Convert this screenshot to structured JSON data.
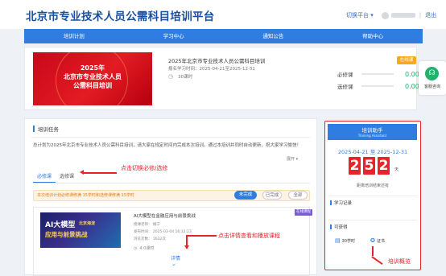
{
  "header": {
    "title": "北京市专业技术人员公需科目培训平台",
    "switch_platform": "切换平台 ▾",
    "logout": "退出",
    "separator": "|"
  },
  "nav": {
    "items": [
      "培训计划",
      "学习中心",
      "通知公告",
      "帮助中心"
    ]
  },
  "plan_card": {
    "cover_text_line1": "2025年",
    "cover_text_line2": "北京市专业技术人员",
    "cover_text_line3": "公需科目培训",
    "title": "2025年北京市专业技术人员公需科目培训",
    "date": "报名学习时间：2025-04-21至2025-12-31",
    "hours": "30课时",
    "badge": "在线课",
    "required_label": "必修课",
    "required_value": "0.00%",
    "elective_label": "选修课",
    "elective_value": "0.00%"
  },
  "float_widget": {
    "label": "客服咨询"
  },
  "task_card": {
    "section_title": "培训任务",
    "plan_text": "总计划为2025年北京市专业技术人员公需科目培训，请大家在规定时间内完成本次培训。通过本培训并同时自动更新，祝大家学习愉快！",
    "more": "展开 ▾",
    "tab_required": "必修课",
    "tab_elective": "选修课",
    "notice": "本次培训计划必修课修满 15学时和选修课修满 15学时",
    "filters": [
      "未完成",
      "已完成",
      "全部"
    ]
  },
  "course": {
    "img_line1": "AI大模型",
    "img_line2": "应用与前景挑战",
    "img_tag": "北京海淀",
    "tag": "在线课程",
    "title": "AI大模型在金融应用与前景挑战",
    "teacher": "授课老师：  姚宁",
    "time": "发布时间：  2025-03-04 16:32:23",
    "views": "浏览次数：  1632次",
    "hours": "4.0课时",
    "detail": "详情",
    "chevron": "⌄"
  },
  "assistant": {
    "title": "培训助手",
    "subtitle": "Training Assistant",
    "date": "2025-04-21 至 2025-12-31",
    "digits": [
      "2",
      "5",
      "2"
    ],
    "unit": "天",
    "remaining": "距离培训结束还有",
    "study_records": "学习记录",
    "earned": "可获得",
    "hours_earned": "30学时",
    "certificate": "证书"
  },
  "annotations": {
    "tab_hint": "点击切换必修/选修",
    "detail_hint": "点击详情查看和播放课程",
    "overview_hint": "培训概览"
  }
}
